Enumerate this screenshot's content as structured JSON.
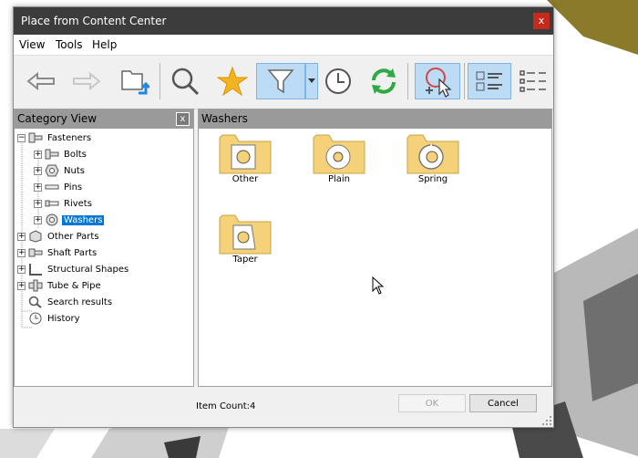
{
  "window": {
    "title": "Place from Content Center",
    "close_glyph": "x"
  },
  "menu": {
    "items": [
      "View",
      "Tools",
      "Help"
    ]
  },
  "toolbar": {
    "buttons": [
      "back-arrow-icon",
      "forward-arrow-icon",
      "place-folder-icon",
      "search-icon",
      "favorites-star-icon",
      "filter-icon",
      "filter-dropdown-icon",
      "history-clock-icon",
      "refresh-icon",
      "place-pointer-icon",
      "tree-view-icon",
      "list-view-icon"
    ],
    "active": [
      "filter-icon",
      "place-pointer-icon",
      "tree-view-icon"
    ]
  },
  "category_view": {
    "title": "Category View",
    "close_glyph": "x",
    "tree": [
      {
        "label": "Fasteners",
        "level": 0,
        "expanded": true,
        "icon": "fasteners-icon"
      },
      {
        "label": "Bolts",
        "level": 1,
        "icon": "bolt-icon"
      },
      {
        "label": "Nuts",
        "level": 1,
        "icon": "nut-icon"
      },
      {
        "label": "Pins",
        "level": 1,
        "icon": "pin-icon"
      },
      {
        "label": "Rivets",
        "level": 1,
        "icon": "rivet-icon"
      },
      {
        "label": "Washers",
        "level": 1,
        "icon": "washer-icon",
        "selected": true
      },
      {
        "label": "Other Parts",
        "level": 0,
        "icon": "other-parts-icon"
      },
      {
        "label": "Shaft Parts",
        "level": 0,
        "icon": "shaft-parts-icon"
      },
      {
        "label": "Structural Shapes",
        "level": 0,
        "icon": "structural-shapes-icon"
      },
      {
        "label": "Tube & Pipe",
        "level": 0,
        "icon": "tube-pipe-icon"
      },
      {
        "label": "Search results",
        "level": 0,
        "icon": "search-results-icon",
        "no_expander": true
      },
      {
        "label": "History",
        "level": 0,
        "icon": "history-icon",
        "no_expander": true
      }
    ]
  },
  "content": {
    "title": "Washers",
    "items": [
      {
        "label": "Other"
      },
      {
        "label": "Plain"
      },
      {
        "label": "Spring"
      },
      {
        "label": "Taper"
      }
    ]
  },
  "footer": {
    "item_count": "Item Count:4",
    "ok": "OK",
    "cancel": "Cancel"
  },
  "colors": {
    "selection": "#0078d7",
    "folder": "#f5d27a",
    "titlebar": "#3c3c3c",
    "close": "#c42b1c"
  }
}
